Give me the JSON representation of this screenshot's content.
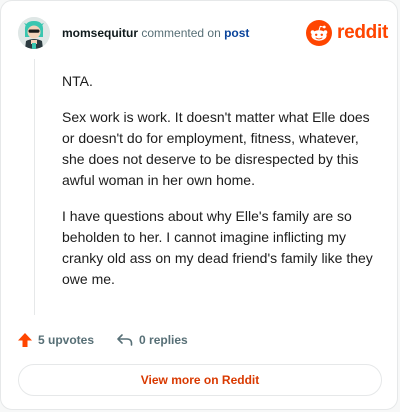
{
  "comment": {
    "username": "momsequitur",
    "action_text": "commented on",
    "target_link": "post",
    "paragraphs": [
      "NTA.",
      "Sex work is work. It doesn't matter what Elle does or doesn't do for employment, fitness, whatever, she does not deserve to be disrespected by this awful woman in her own home.",
      "I have questions about why Elle's family are so beholden to her. I cannot imagine inflicting my cranky old ass on my dead friend's family like they owe me."
    ],
    "upvotes_label": "5 upvotes",
    "replies_label": "0 replies"
  },
  "brand": {
    "name": "reddit",
    "color": "#ff4500"
  },
  "footer": {
    "view_more_label": "View more on Reddit",
    "view_more_color": "#d93900"
  },
  "icons": {
    "upvote": "upvote-arrow-icon",
    "reply": "reply-arrow-icon",
    "logo": "reddit-snoo-icon"
  }
}
